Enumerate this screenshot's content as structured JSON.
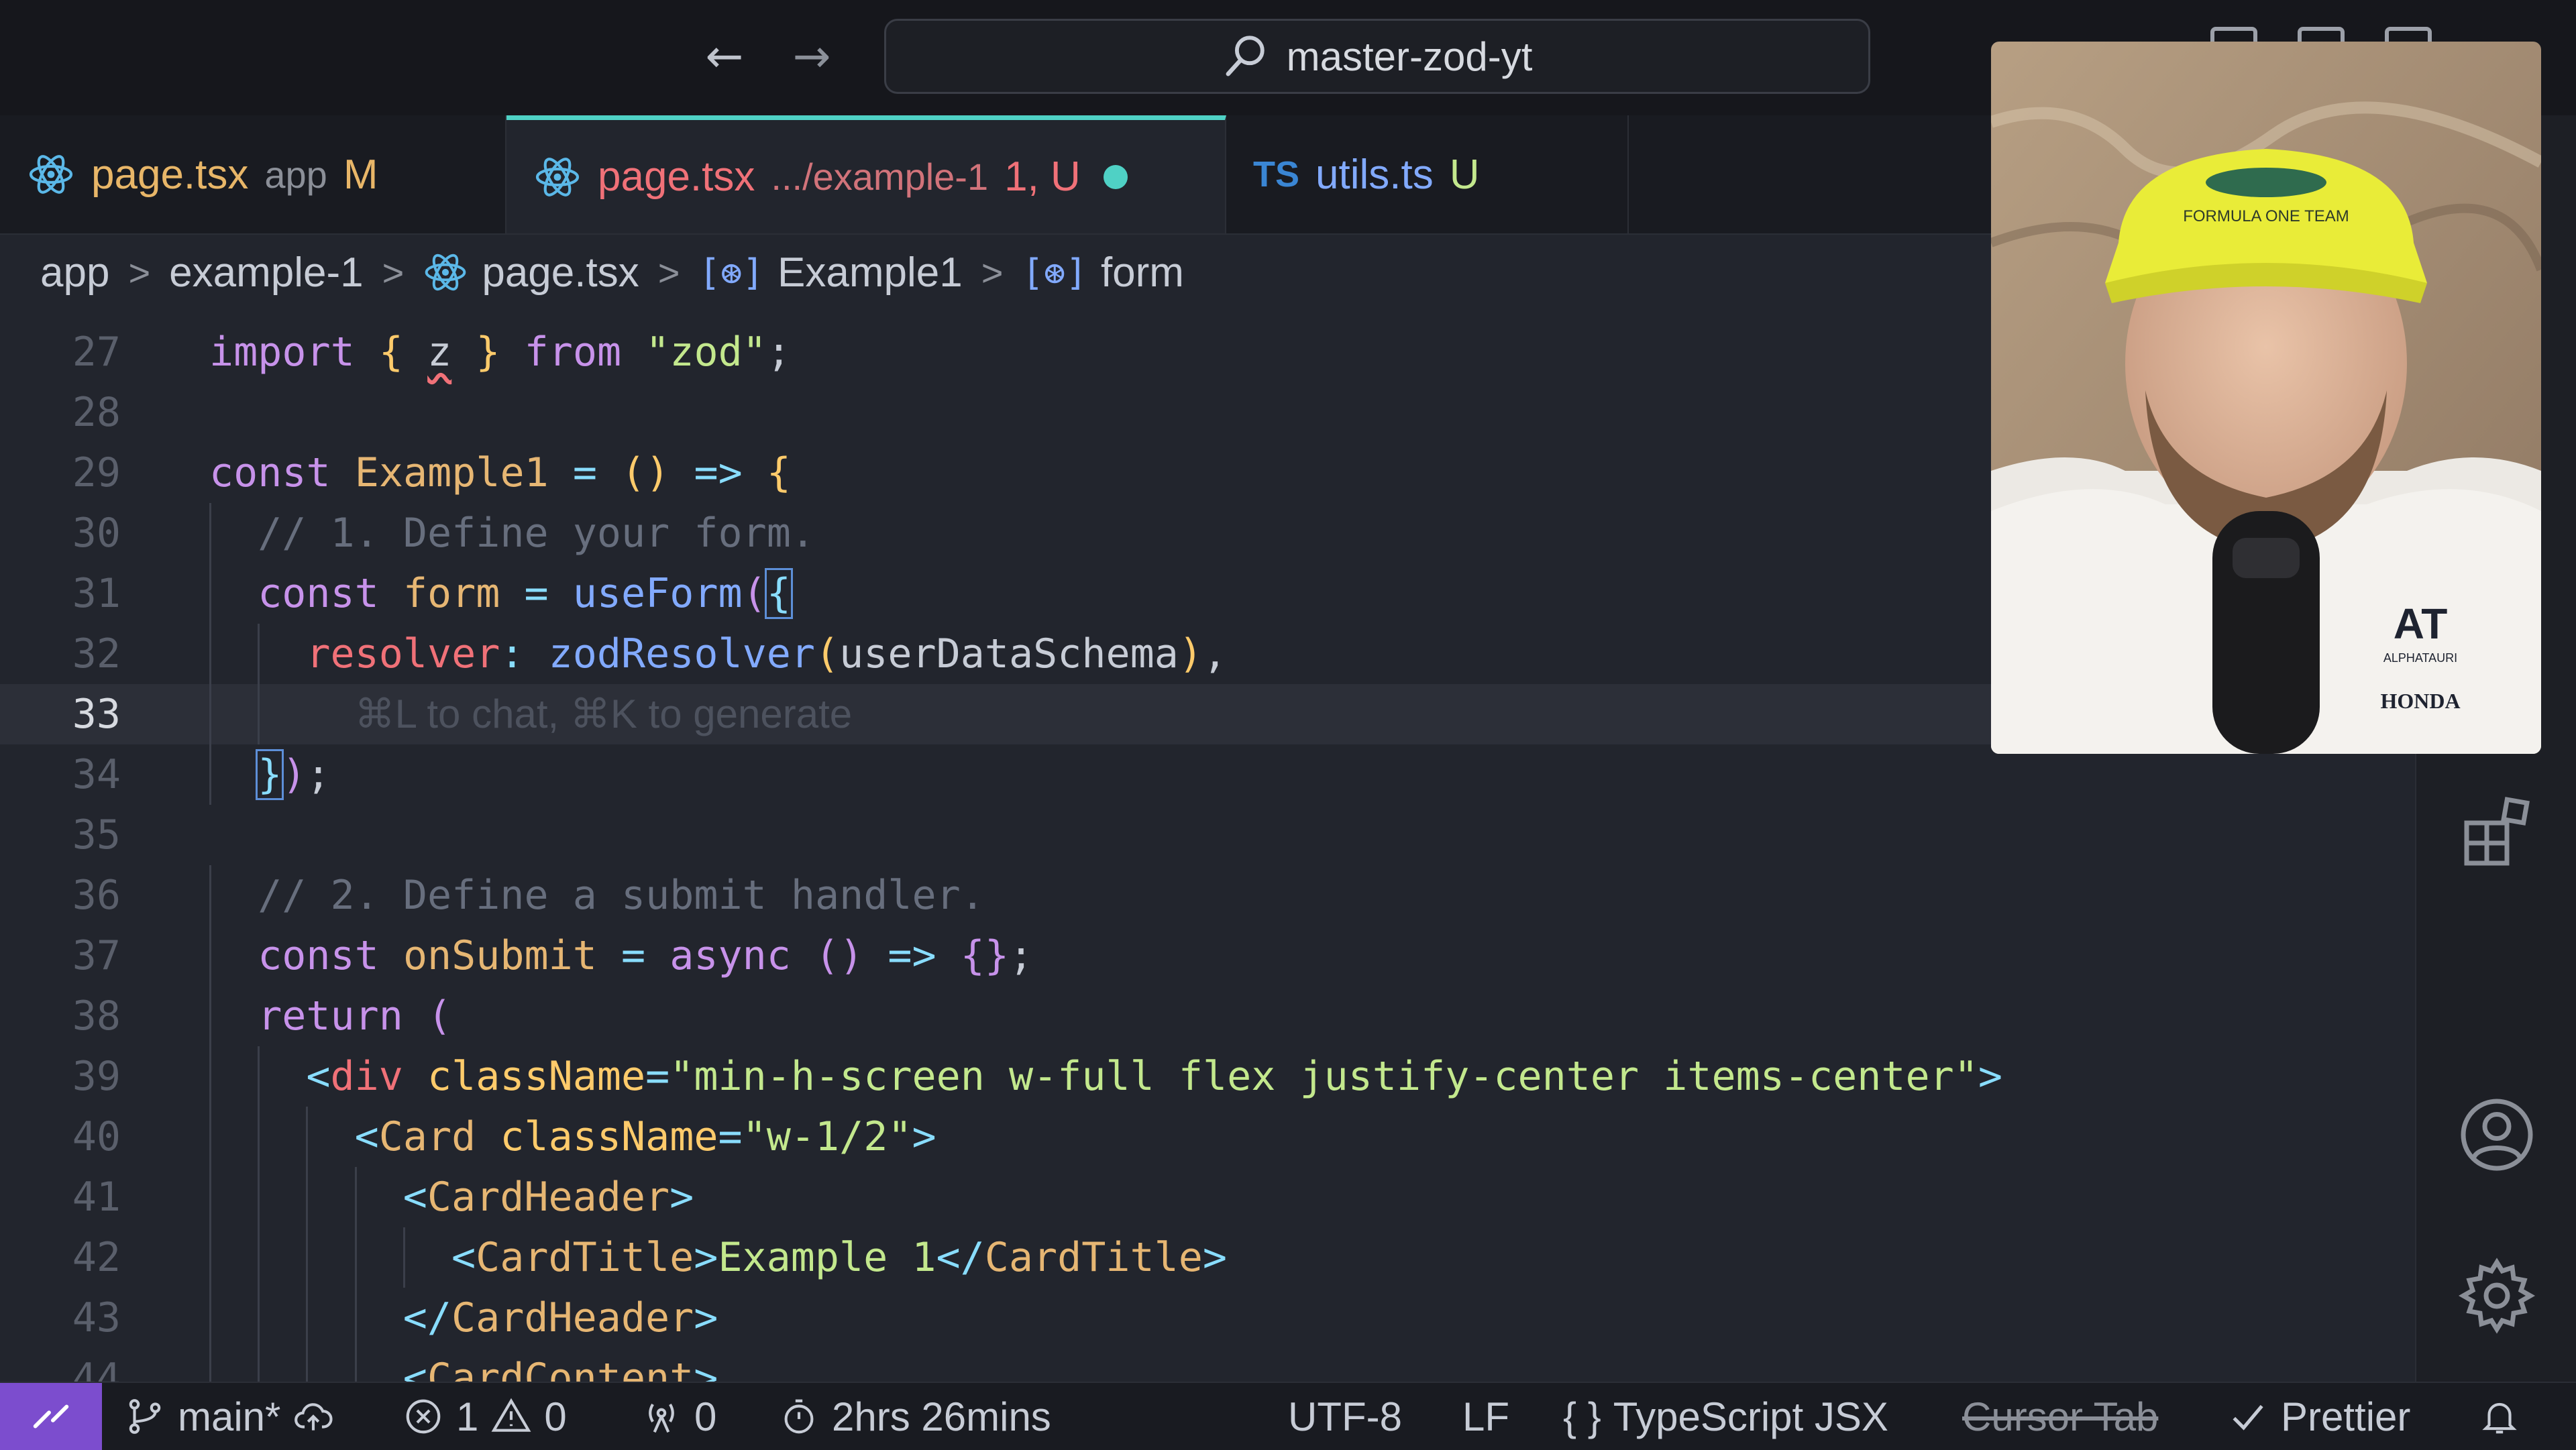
{
  "titlebar": {
    "search_label": "master-zod-yt",
    "back_glyph": "←",
    "forward_glyph": "→"
  },
  "tabs": [
    {
      "icon": "react-icon",
      "name": "page.tsx",
      "dir": "app",
      "status": "M"
    },
    {
      "icon": "react-icon",
      "name": "page.tsx",
      "dir": ".../example-1",
      "status": "1, U",
      "dirty": true
    },
    {
      "icon": "ts-badge-icon",
      "badge": "TS",
      "name": "utils.ts",
      "status": "U"
    }
  ],
  "breadcrumb": {
    "items": [
      "app",
      "example-1",
      "page.tsx",
      "Example1",
      "form"
    ],
    "separator": ">",
    "symbol_glyph": "[⊛]"
  },
  "editor": {
    "current_line": 33,
    "ghost_hint": "⌘L to chat, ⌘K to generate",
    "lines": [
      {
        "n": "27",
        "parts": [
          [
            "kw",
            "import "
          ],
          [
            "brace",
            "{ "
          ],
          [
            "plain",
            "z"
          ],
          [
            "brace",
            " } "
          ],
          [
            "kw",
            "from "
          ],
          [
            "str",
            "\"zod\""
          ],
          [
            "plain",
            ";"
          ]
        ]
      },
      {
        "n": "28",
        "parts": []
      },
      {
        "n": "29",
        "parts": [
          [
            "kw",
            "const "
          ],
          [
            "var2",
            "Example1"
          ],
          [
            "punc",
            " = "
          ],
          [
            "brace",
            "() "
          ],
          [
            "punc",
            "=> "
          ],
          [
            "brace",
            "{"
          ]
        ]
      },
      {
        "n": "30",
        "parts": [
          [
            "cmt",
            "// 1. Define your form."
          ]
        ]
      },
      {
        "n": "31",
        "parts": [
          [
            "kw",
            "const "
          ],
          [
            "var2",
            "form"
          ],
          [
            "punc",
            " = "
          ],
          [
            "fn",
            "useForm"
          ],
          [
            "kw",
            "("
          ],
          [
            "punc",
            "{"
          ]
        ]
      },
      {
        "n": "32",
        "parts": [
          [
            "tag",
            "resolver"
          ],
          [
            "punc",
            ": "
          ],
          [
            "fn",
            "zodResolver"
          ],
          [
            "brace",
            "("
          ],
          [
            "plain",
            "userDataSchema"
          ],
          [
            "brace",
            ")"
          ],
          [
            "plain",
            ","
          ]
        ]
      },
      {
        "n": "33",
        "parts": []
      },
      {
        "n": "34",
        "parts": [
          [
            "punc",
            "}"
          ],
          [
            "kw",
            ")"
          ],
          [
            "plain",
            ";"
          ]
        ]
      },
      {
        "n": "35",
        "parts": []
      },
      {
        "n": "36",
        "parts": [
          [
            "cmt",
            "// 2. Define a submit handler."
          ]
        ]
      },
      {
        "n": "37",
        "parts": [
          [
            "kw",
            "const "
          ],
          [
            "var2",
            "onSubmit"
          ],
          [
            "punc",
            " = "
          ],
          [
            "kw",
            "async "
          ],
          [
            "kw",
            "() "
          ],
          [
            "punc",
            "=> "
          ],
          [
            "kw",
            "{}"
          ],
          [
            "plain",
            ";"
          ]
        ]
      },
      {
        "n": "38",
        "parts": [
          [
            "kw",
            "return "
          ],
          [
            "kw",
            "("
          ]
        ]
      },
      {
        "n": "39",
        "parts": [
          [
            "punc",
            "<"
          ],
          [
            "tag",
            "div "
          ],
          [
            "attr",
            "className"
          ],
          [
            "punc",
            "="
          ],
          [
            "str",
            "\"min-h-screen w-full flex justify-center items-center\""
          ],
          [
            "punc",
            ">"
          ]
        ]
      },
      {
        "n": "40",
        "parts": [
          [
            "punc",
            "<"
          ],
          [
            "var2",
            "Card "
          ],
          [
            "attr",
            "className"
          ],
          [
            "punc",
            "="
          ],
          [
            "str",
            "\"w-1/2\""
          ],
          [
            "punc",
            ">"
          ]
        ]
      },
      {
        "n": "41",
        "parts": [
          [
            "punc",
            "<"
          ],
          [
            "var2",
            "CardHeader"
          ],
          [
            "punc",
            ">"
          ]
        ]
      },
      {
        "n": "42",
        "parts": [
          [
            "punc",
            "<"
          ],
          [
            "var2",
            "CardTitle"
          ],
          [
            "punc",
            ">"
          ],
          [
            "str",
            "Example 1"
          ],
          [
            "punc",
            "</"
          ],
          [
            "var2",
            "CardTitle"
          ],
          [
            "punc",
            ">"
          ]
        ]
      },
      {
        "n": "43",
        "parts": [
          [
            "punc",
            "</"
          ],
          [
            "var2",
            "CardHeader"
          ],
          [
            "punc",
            ">"
          ]
        ]
      },
      {
        "n": "44",
        "parts": [
          [
            "punc",
            "<"
          ],
          [
            "var2",
            "CardContent"
          ],
          [
            "punc",
            ">"
          ]
        ]
      }
    ]
  },
  "statusbar": {
    "branch": "main*",
    "errors": "1",
    "warnings": "0",
    "ports": "0",
    "time": "2hrs 26mins",
    "encoding": "UTF-8",
    "eol": "LF",
    "braces": "{ }",
    "language": "TypeScript JSX",
    "cursor_tab": "Cursor Tab",
    "prettier": "Prettier"
  },
  "webcam": {
    "cap_text": "FORMULA ONE TEAM",
    "shirt_logo": "AT",
    "shirt_sub": "ALPHATAURI",
    "shirt_brand": "HONDA"
  },
  "colors": {
    "accent": "#4fd1c5",
    "remote": "#7c4dce",
    "keyword": "#c792ea",
    "string": "#c3e88d",
    "function": "#82aaff"
  }
}
